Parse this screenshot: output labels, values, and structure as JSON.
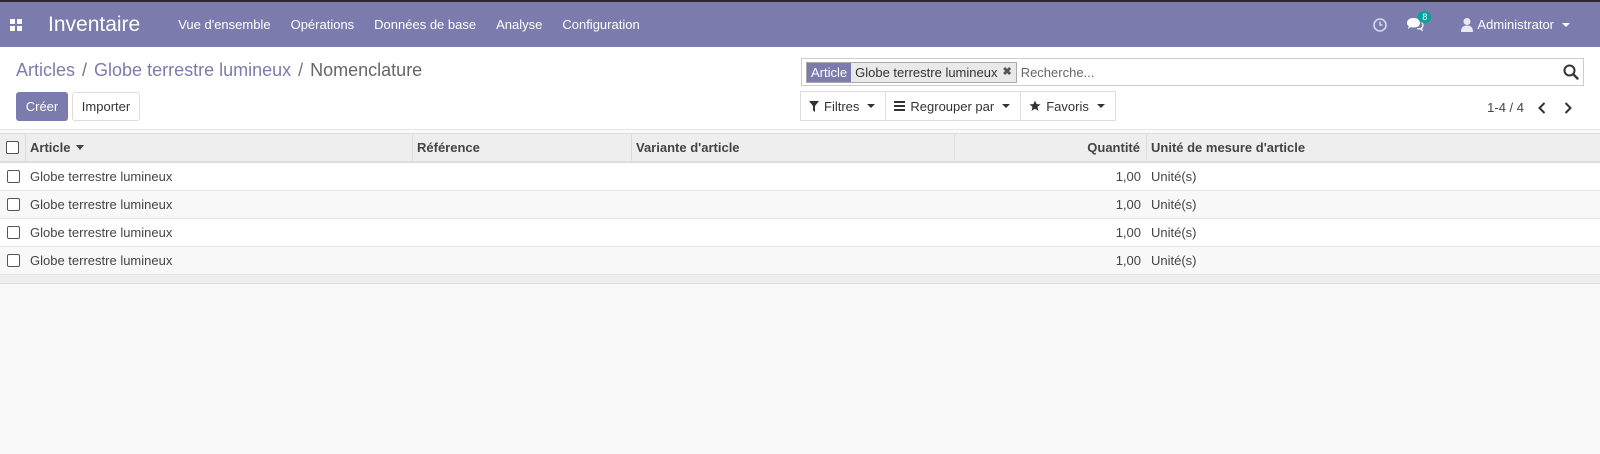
{
  "navbar": {
    "app_title": "Inventaire",
    "menu": [
      "Vue d'ensemble",
      "Opérations",
      "Données de base",
      "Analyse",
      "Configuration"
    ],
    "messages_badge": "8",
    "user_name": "Administrator",
    "bg_color": "#7c7bad"
  },
  "breadcrumb": {
    "items": [
      "Articles",
      "Globe terrestre lumineux"
    ],
    "separator": "/",
    "current": "Nomenclature"
  },
  "buttons": {
    "create": "Créer",
    "import": "Importer"
  },
  "search": {
    "facet_category": "Article",
    "facet_value": "Globe terrestre lumineux",
    "placeholder": "Recherche..."
  },
  "filters": {
    "filters_label": "Filtres",
    "group_label": "Regrouper par",
    "favorites_label": "Favoris"
  },
  "pager": {
    "value": "1-4 / 4"
  },
  "table": {
    "columns": [
      "Article",
      "Référence",
      "Variante d'article",
      "Quantité",
      "Unité de mesure d'article"
    ],
    "sorted_column": "Article",
    "rows": [
      {
        "article": "Globe terrestre lumineux",
        "reference": "",
        "variant": "",
        "quantity": "1,00",
        "uom": "Unité(s)"
      },
      {
        "article": "Globe terrestre lumineux",
        "reference": "",
        "variant": "",
        "quantity": "1,00",
        "uom": "Unité(s)"
      },
      {
        "article": "Globe terrestre lumineux",
        "reference": "",
        "variant": "",
        "quantity": "1,00",
        "uom": "Unité(s)"
      },
      {
        "article": "Globe terrestre lumineux",
        "reference": "",
        "variant": "",
        "quantity": "1,00",
        "uom": "Unité(s)"
      }
    ]
  }
}
